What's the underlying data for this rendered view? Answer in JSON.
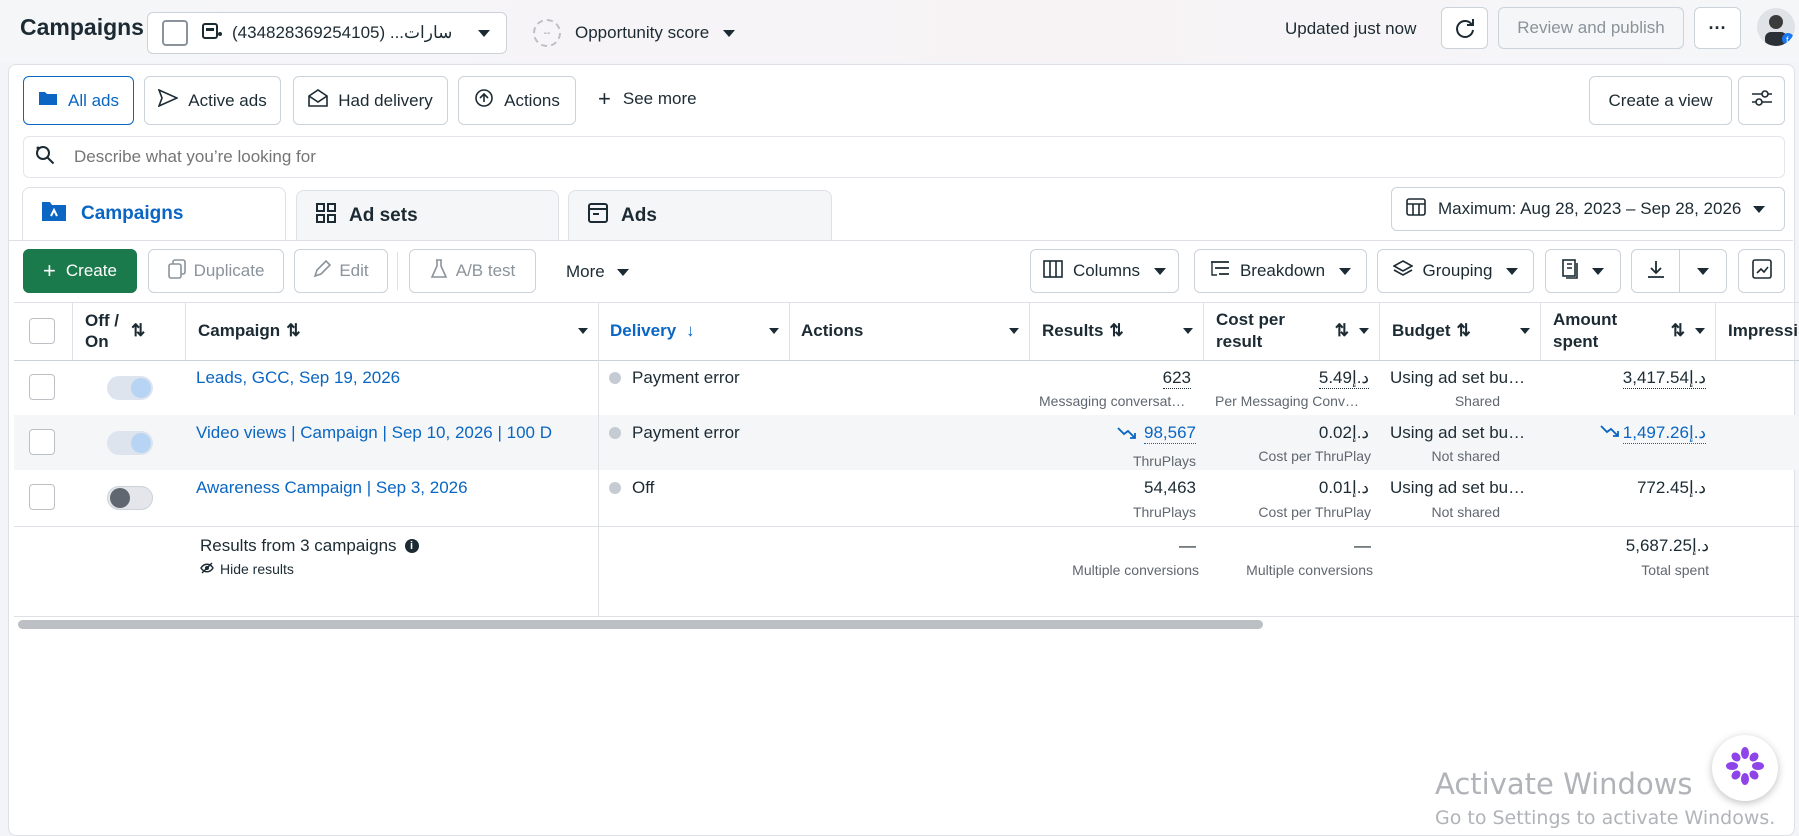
{
  "topbar": {
    "title": "Campaigns",
    "account": "(434828369254105) ...سارات",
    "opportunity_prefix": "--",
    "opportunity_label": "Opportunity score",
    "updated": "Updated just now",
    "review_publish": "Review and publish",
    "more": "···"
  },
  "filters": {
    "all_ads": "All ads",
    "active_ads": "Active ads",
    "had_delivery": "Had delivery",
    "actions": "Actions",
    "see_more": "See more",
    "create_view": "Create a view"
  },
  "search": {
    "placeholder": "Describe what you’re looking for"
  },
  "tabs": {
    "campaigns": "Campaigns",
    "ad_sets": "Ad sets",
    "ads": "Ads"
  },
  "date_range": "Maximum: Aug 28, 2023 – Sep 28, 2026",
  "toolbar": {
    "create": "Create",
    "duplicate": "Duplicate",
    "edit": "Edit",
    "ab_test": "A/B test",
    "more": "More",
    "columns": "Columns",
    "breakdown": "Breakdown",
    "grouping": "Grouping"
  },
  "columns": {
    "off_on_1": "Off /",
    "off_on_2": "On",
    "campaign": "Campaign",
    "delivery": "Delivery",
    "actions": "Actions",
    "results": "Results",
    "cpr_1": "Cost per",
    "cpr_2": "result",
    "budget": "Budget",
    "amount_1": "Amount",
    "amount_2": "spent",
    "impressions": "Impressi"
  },
  "rows": [
    {
      "name": "Leads, GCC, Sep 19, 2026",
      "delivery": "Payment error",
      "results": "623",
      "results_sub": "Messaging conversat…",
      "cpr": "د.إ5.49",
      "cpr_sub": "Per Messaging Conv…",
      "budget": "Using ad set bu…",
      "budget_sub": "Shared",
      "amount": "د.إ3,417.54",
      "toggle_on": true
    },
    {
      "name": "Video views | Campaign | Sep 10, 2026 | 100 D",
      "delivery": "Payment error",
      "results": "98,567",
      "results_sub": "ThruPlays",
      "cpr": "د.إ0.02",
      "cpr_sub": "Cost per ThruPlay",
      "budget": "Using ad set bu…",
      "budget_sub": "Not shared",
      "amount": "د.إ1,497.26",
      "toggle_on": true
    },
    {
      "name": "Awareness Campaign | Sep 3, 2026",
      "delivery": "Off",
      "results": "54,463",
      "results_sub": "ThruPlays",
      "cpr": "د.إ0.01",
      "cpr_sub": "Cost per ThruPlay",
      "budget": "Using ad set bu…",
      "budget_sub": "Not shared",
      "amount": "د.إ772.45",
      "toggle_on": false
    }
  ],
  "summary": {
    "label": "Results from 3 campaigns",
    "hide": "Hide results",
    "results": "—",
    "results_sub": "Multiple conversions",
    "cpr": "—",
    "cpr_sub": "Multiple conversions",
    "amount": "د.إ5,687.25",
    "amount_sub": "Total spent"
  },
  "watermark": {
    "line1": "Activate Windows",
    "line2": "Go to Settings to activate Windows."
  },
  "colors": {
    "accent": "#0a66c2",
    "create_green": "#1a7a4c",
    "toggle_on": "#b8d4f5"
  }
}
